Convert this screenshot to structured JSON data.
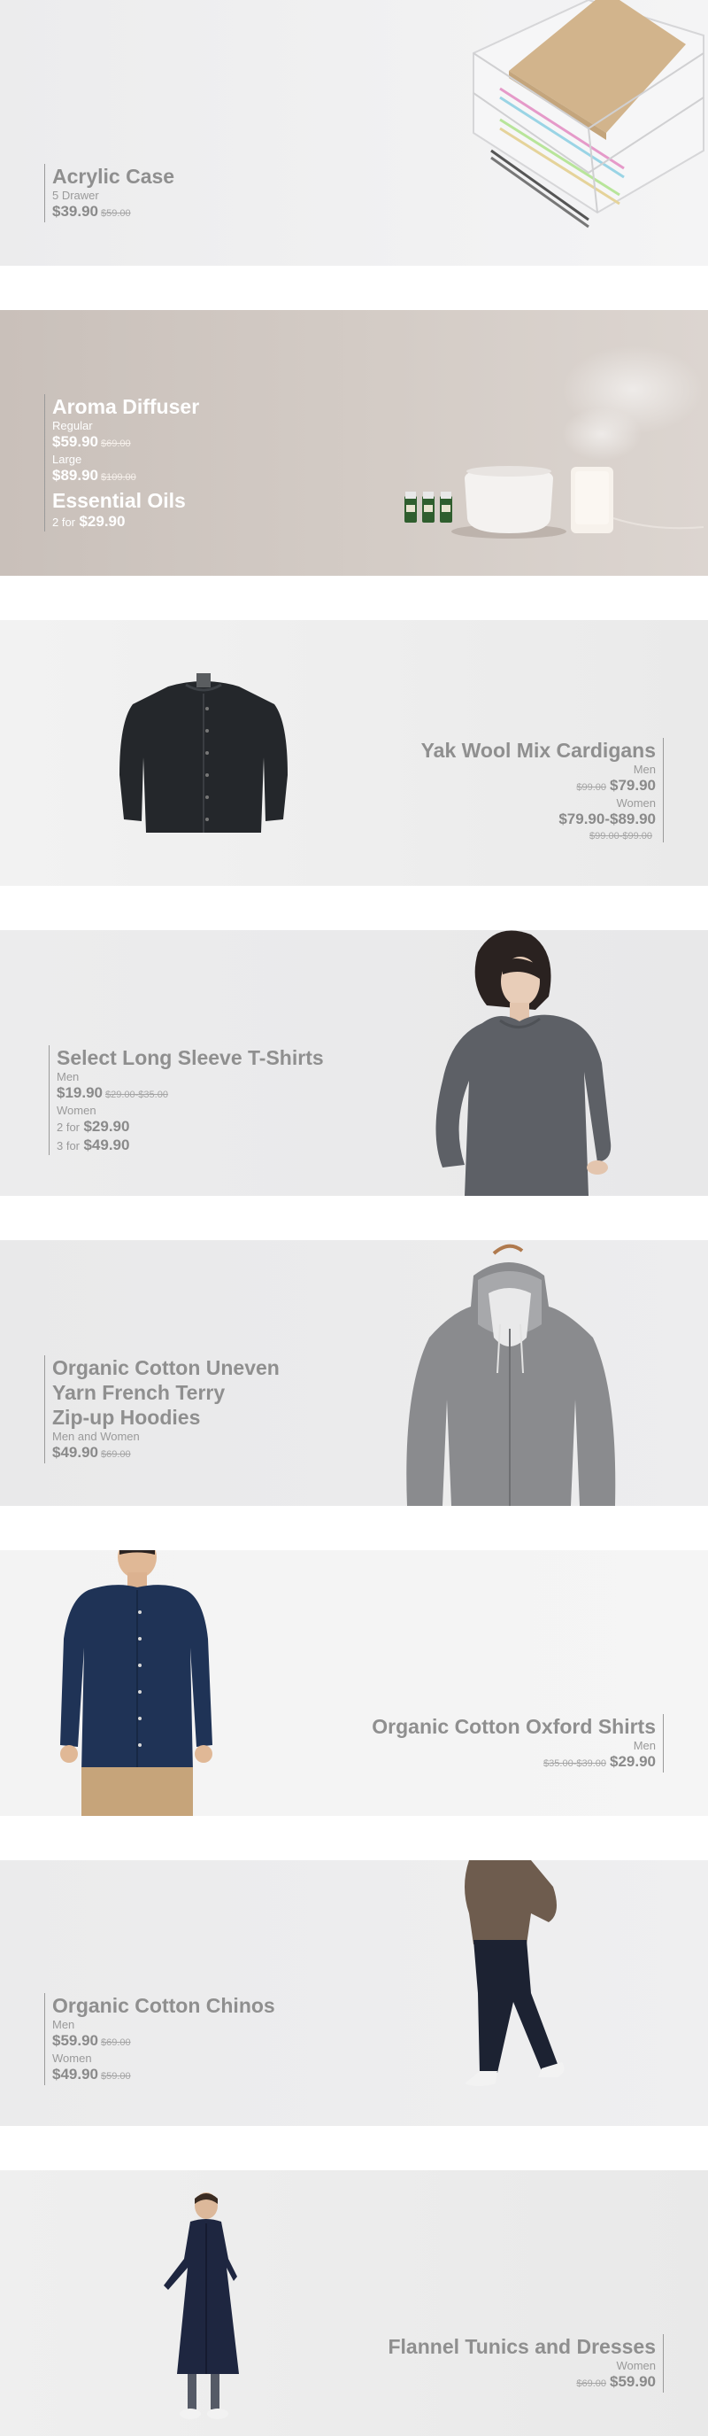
{
  "banners": [
    {
      "title": "Acrylic Case",
      "subtitle": "5 Drawer",
      "price": "$39.90",
      "old_price": "$59.00"
    },
    {
      "title": "Aroma Diffuser",
      "variant1": "Regular",
      "price1": "$59.90",
      "old_price1": "$69.00",
      "variant2": "Large",
      "price2": "$89.90",
      "old_price2": "$109.00",
      "title2": "Essential Oils",
      "deal_prefix": "2 for",
      "deal_price": "$29.90"
    },
    {
      "title": "Yak Wool Mix Cardigans",
      "group1": "Men",
      "old_price1": "$99.00",
      "price1": "$79.90",
      "group2": "Women",
      "price2": "$79.90-$89.90",
      "old_price2": "$99.00-$99.00"
    },
    {
      "title": "Select Long Sleeve T-Shirts",
      "group1": "Men",
      "price1": "$19.90",
      "old_price1": "$29.00-$35.00",
      "group2": "Women",
      "deal1_prefix": "2 for",
      "deal1_price": "$29.90",
      "deal2_prefix": "3 for",
      "deal2_price": "$49.90"
    },
    {
      "title_line1": "Organic Cotton Uneven",
      "title_line2": "Yarn French Terry",
      "title_line3": "Zip-up Hoodies",
      "group": "Men and Women",
      "price": "$49.90",
      "old_price": "$69.00"
    },
    {
      "title": "Organic Cotton Oxford Shirts",
      "group": "Men",
      "old_price": "$35.00-$39.00",
      "price": "$29.90"
    },
    {
      "title": "Organic Cotton Chinos",
      "group1": "Men",
      "price1": "$59.90",
      "old_price1": "$69.00",
      "group2": "Women",
      "price2": "$49.90",
      "old_price2": "$59.00"
    },
    {
      "title": "Flannel Tunics and Dresses",
      "group": "Women",
      "old_price": "$69.00",
      "price": "$59.90"
    }
  ],
  "icons": [
    "acrylic-case-image",
    "aroma-diffuser-image",
    "cardigan-image",
    "tshirt-model-image",
    "hoodie-image",
    "oxford-shirt-model-image",
    "chinos-model-image",
    "dress-model-image"
  ]
}
